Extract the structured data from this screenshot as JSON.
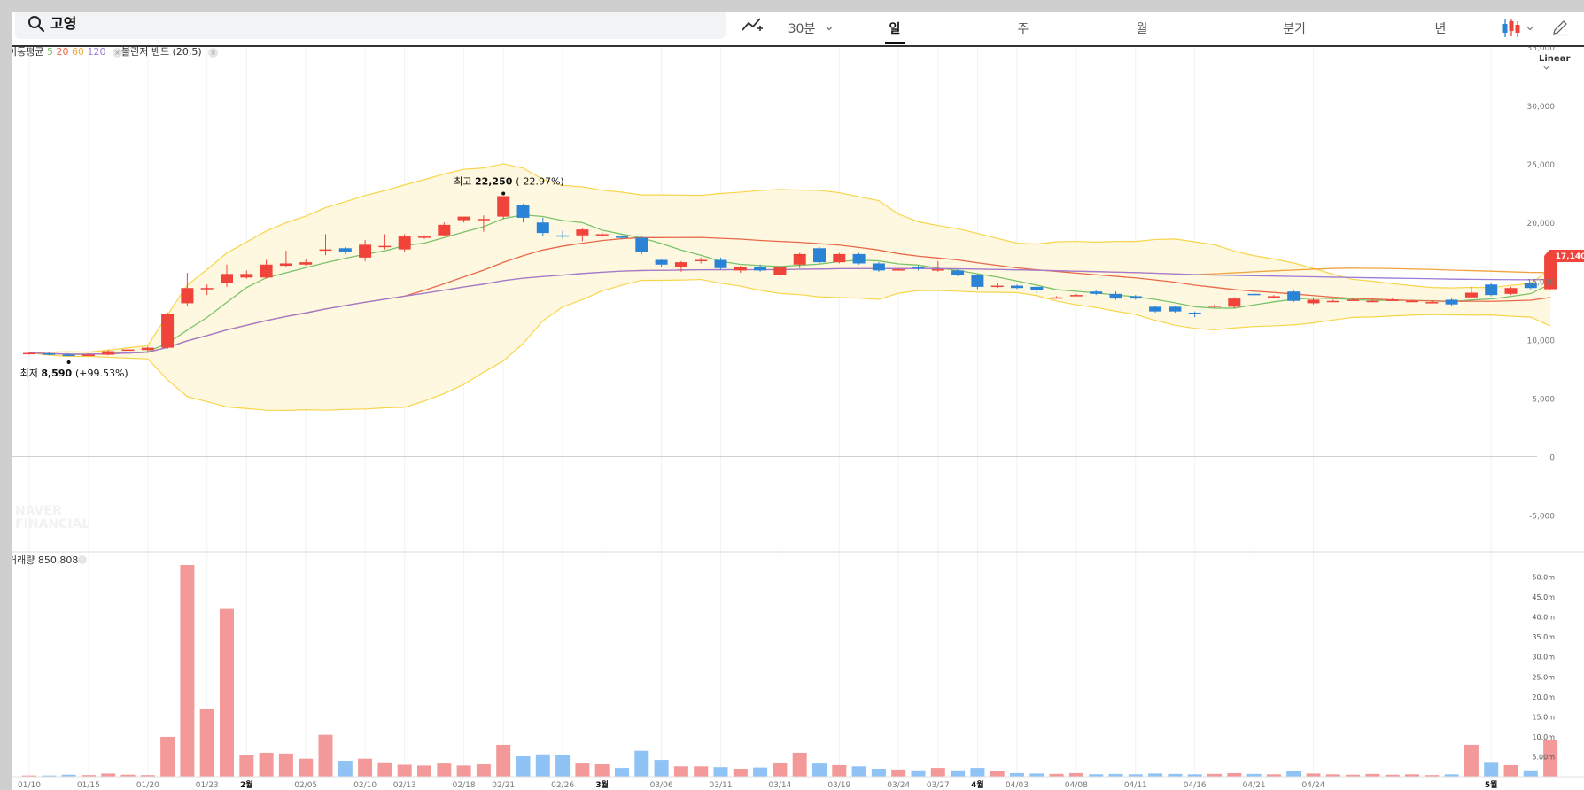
{
  "search": {
    "value": "고영"
  },
  "toolbar": {
    "items": [
      "30분",
      "일",
      "주",
      "월",
      "분기",
      "년"
    ],
    "active": "일"
  },
  "legend": {
    "ma_label": "이동평균",
    "ma_periods": [
      "5",
      "20",
      "60",
      "120"
    ],
    "bb_label": "볼린저 밴드 (20,5)",
    "close": "×"
  },
  "scale": "Linear",
  "watermark": [
    "NAVER",
    "FINANCIAL"
  ],
  "colors": {
    "up": "#f0433a",
    "down": "#2b83d6",
    "ma5": "#7ac36a",
    "ma20": "#e8684a",
    "ma60": "#f2a33c",
    "ma120": "#9f7ad6",
    "band_fill": "#fff8e0",
    "band_line": "#f7d54a",
    "volume_up": "#f4999a",
    "volume_down": "#8fc3f5"
  },
  "chart_data": {
    "type": "candlestick",
    "ylim": [
      -7000,
      35000
    ],
    "y_ticks": [
      35000,
      30000,
      25000,
      20000,
      15000,
      10000,
      5000,
      0,
      -5000
    ],
    "y_tick_labels": [
      "35,000",
      "30,000",
      "25,000",
      "20,000",
      "15,000",
      "10,000",
      "5,000",
      "0",
      "-5,000"
    ],
    "x_labels": [
      "01/10",
      "01/15",
      "01/20",
      "01/23",
      "2월",
      "02/05",
      "02/10",
      "02/13",
      "02/18",
      "02/21",
      "02/26",
      "3월",
      "03/06",
      "03/11",
      "03/14",
      "03/19",
      "03/24",
      "03/27",
      "4월",
      "04/03",
      "04/08",
      "04/11",
      "04/16",
      "04/21",
      "04/24",
      "5월"
    ],
    "current_price": 17140,
    "current_price_label": "17,140",
    "annotations": {
      "high_label": "최고",
      "high_value": "22,250",
      "high_change": "(-22.97%)",
      "low_label": "최저",
      "low_value": "8,590",
      "low_change": "(+99.53%)"
    },
    "candles": [
      [
        8800,
        8850,
        8700,
        8900
      ],
      [
        8800,
        8750,
        8650,
        8900
      ],
      [
        8700,
        8650,
        8590,
        8800
      ],
      [
        8650,
        8700,
        8600,
        8800
      ],
      [
        8700,
        9000,
        8650,
        9100
      ],
      [
        9100,
        9150,
        9000,
        9200
      ],
      [
        9100,
        9300,
        9000,
        9400
      ],
      [
        9300,
        12200,
        9200,
        12300
      ],
      [
        13100,
        14400,
        12900,
        15700
      ],
      [
        14400,
        14400,
        13800,
        14700
      ],
      [
        14800,
        15600,
        14500,
        16400
      ],
      [
        15300,
        15600,
        15200,
        15900
      ],
      [
        15300,
        16400,
        15200,
        16800
      ],
      [
        16300,
        16500,
        16200,
        17600
      ],
      [
        16400,
        16600,
        16300,
        16900
      ],
      [
        17600,
        17700,
        17200,
        19000
      ],
      [
        17800,
        17500,
        17300,
        17900
      ],
      [
        17000,
        18100,
        16700,
        18500
      ],
      [
        18000,
        18000,
        17700,
        19000
      ],
      [
        17700,
        18800,
        17500,
        19000
      ],
      [
        18700,
        18800,
        18600,
        18900
      ],
      [
        18900,
        19800,
        18800,
        20000
      ],
      [
        20200,
        20500,
        20000,
        20500
      ],
      [
        20300,
        20300,
        19200,
        20600
      ],
      [
        20500,
        22250,
        20300,
        22250
      ],
      [
        21500,
        20400,
        20000,
        21600
      ],
      [
        20000,
        19100,
        18800,
        20400
      ],
      [
        18900,
        18800,
        18600,
        19300
      ],
      [
        18900,
        19400,
        18400,
        19500
      ],
      [
        19000,
        19000,
        18700,
        19200
      ],
      [
        18800,
        18700,
        18600,
        18900
      ],
      [
        18700,
        17500,
        17300,
        18800
      ],
      [
        16800,
        16400,
        16200,
        16900
      ],
      [
        16200,
        16600,
        15800,
        16700
      ],
      [
        16800,
        16800,
        16500,
        17000
      ],
      [
        16800,
        16100,
        16000,
        17000
      ],
      [
        15900,
        16200,
        15700,
        16300
      ],
      [
        16200,
        15900,
        15800,
        16400
      ],
      [
        15500,
        16200,
        15200,
        16300
      ],
      [
        16400,
        17300,
        16100,
        17400
      ],
      [
        17800,
        16600,
        16500,
        17900
      ],
      [
        16600,
        17300,
        16500,
        17400
      ],
      [
        17300,
        16500,
        16400,
        17400
      ],
      [
        16500,
        15900,
        15800,
        16600
      ],
      [
        16000,
        16000,
        15900,
        16100
      ],
      [
        16200,
        16100,
        15900,
        16300
      ],
      [
        16000,
        16000,
        15800,
        16700
      ],
      [
        15900,
        15500,
        15400,
        16000
      ],
      [
        15500,
        14500,
        14300,
        15600
      ],
      [
        14500,
        14600,
        14400,
        14800
      ],
      [
        14600,
        14400,
        14300,
        14700
      ],
      [
        14500,
        14200,
        13900,
        14600
      ],
      [
        13600,
        13600,
        13500,
        13700
      ],
      [
        13800,
        13800,
        13700,
        13900
      ],
      [
        14100,
        13900,
        13800,
        14200
      ],
      [
        13900,
        13500,
        13400,
        14100
      ],
      [
        13700,
        13500,
        13400,
        13800
      ],
      [
        12800,
        12400,
        12300,
        12900
      ],
      [
        12800,
        12400,
        12300,
        12900
      ],
      [
        12300,
        12200,
        11900,
        12400
      ],
      [
        12800,
        12900,
        12700,
        13000
      ],
      [
        12800,
        13500,
        12700,
        13600
      ],
      [
        13900,
        13800,
        13700,
        14000
      ],
      [
        13700,
        13700,
        13600,
        13800
      ],
      [
        14100,
        13300,
        13200,
        14200
      ],
      [
        13100,
        13400,
        13000,
        13500
      ],
      [
        13300,
        13300,
        13200,
        13400
      ],
      [
        13400,
        13400,
        13300,
        13500
      ],
      [
        13300,
        13300,
        13200,
        13400
      ],
      [
        13400,
        13400,
        13300,
        13500
      ],
      [
        13300,
        13300,
        13200,
        13400
      ],
      [
        13200,
        13200,
        13100,
        13300
      ],
      [
        13400,
        13000,
        12900,
        13500
      ],
      [
        13600,
        14000,
        13500,
        14500
      ],
      [
        14700,
        13800,
        13700,
        14800
      ],
      [
        13900,
        14400,
        13800,
        14500
      ],
      [
        14800,
        14400,
        14300,
        14900
      ],
      [
        14300,
        17140,
        14200,
        17200
      ]
    ],
    "volume": {
      "title": "거래량",
      "last_value": "850,808",
      "y_tick_labels": [
        "50.0m",
        "45.0m",
        "40.0m",
        "35.0m",
        "30.0m",
        "25.0m",
        "20.0m",
        "15.0m",
        "10.0m",
        "5.00m"
      ],
      "y_ticks": [
        50,
        45,
        40,
        35,
        30,
        25,
        20,
        15,
        10,
        5
      ],
      "ylim": [
        0,
        55
      ],
      "values": [
        0.3,
        0.3,
        0.5,
        0.4,
        0.8,
        0.5,
        0.4,
        10,
        53,
        17,
        42,
        5.5,
        6,
        5.8,
        4.5,
        10.5,
        4,
        4.5,
        3.6,
        3,
        2.8,
        3.3,
        2.8,
        3.1,
        8,
        5.1,
        5.6,
        5.4,
        3.3,
        3.1,
        2.2,
        6.5,
        4.2,
        2.6,
        2.6,
        2.4,
        2,
        2.3,
        3.5,
        6,
        3.3,
        2.9,
        2.6,
        2,
        1.8,
        1.6,
        2.2,
        1.6,
        2.2,
        1.4,
        0.9,
        0.8,
        0.7,
        0.9,
        0.6,
        0.7,
        0.6,
        0.8,
        0.7,
        0.6,
        0.7,
        0.9,
        0.7,
        0.6,
        1.4,
        0.8,
        0.6,
        0.5,
        0.7,
        0.5,
        0.6,
        0.4,
        0.6,
        8,
        3.7,
        2.9,
        1.6,
        9.3
      ]
    }
  }
}
